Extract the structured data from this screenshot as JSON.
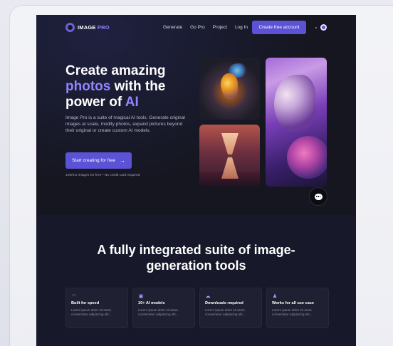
{
  "nav": {
    "logo_text": "IMAGE",
    "logo_accent": "PRO",
    "links": [
      "Generate",
      "Go Pro",
      "Project",
      "Log In"
    ],
    "cta": "Create free account",
    "theme_icon": "moon-icon"
  },
  "hero": {
    "headline_1": "Create amazing",
    "headline_accent_1": "photos",
    "headline_2": "with the",
    "headline_3": "power of",
    "headline_accent_2": "AI",
    "description": "Image Pro is a suite of magical AI tools. Generate original images at scale, modify photos, expand pictures beyond their original or create custom AI models.",
    "cta": "Start creating for free",
    "cta_icon": "arrow-right-icon",
    "fine_print": "100/mo images for free • No credit card required"
  },
  "chat": {
    "icon": "chat-bubble-icon"
  },
  "section": {
    "title_line_1": "A fully integrated suite of image-",
    "title_line_2": "generation tools"
  },
  "features": [
    {
      "icon": "speedometer-icon",
      "title": "Built for speed",
      "body": "Lorem ipsum dolor sit amet, consectetur adipiscing elit..."
    },
    {
      "icon": "robot-icon",
      "title": "10+ AI models",
      "body": "Lorem ipsum dolor sit amet, consectetur adipiscing elit..."
    },
    {
      "icon": "cloud-download-icon",
      "title": "Downloads required",
      "body": "Lorem ipsum dolor sit amet, consectetur adipiscing elit..."
    },
    {
      "icon": "user-icon",
      "title": "Works for all use case",
      "body": "Lorem ipsum dolor sit amet, consectetur adipiscing elit..."
    }
  ],
  "colors": {
    "accent": "#5b52d6",
    "accent_text": "#8f86ff",
    "background": "#15161f"
  }
}
